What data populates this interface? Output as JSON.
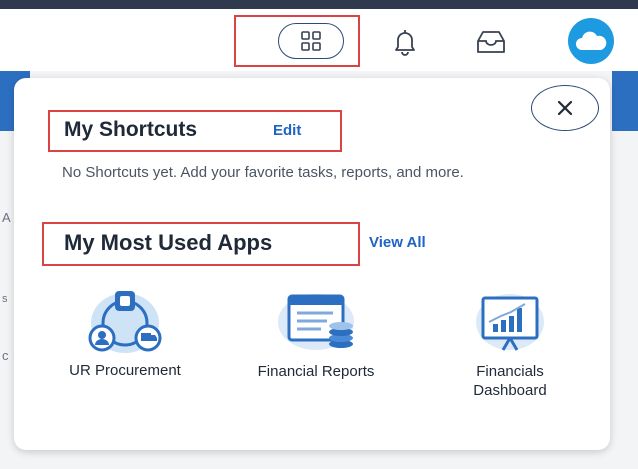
{
  "background": {
    "fragments": [
      "A",
      "s",
      "c"
    ]
  },
  "topbar": {
    "icons": [
      "apps-grid-icon",
      "bell-icon",
      "inbox-icon",
      "cloud-avatar-icon"
    ]
  },
  "panel": {
    "shortcuts": {
      "title": "My Shortcuts",
      "edit_label": "Edit",
      "empty_text": "No Shortcuts yet. Add your favorite tasks, reports, and more."
    },
    "most_used": {
      "title": "My Most Used Apps",
      "view_all_label": "View All",
      "apps": [
        {
          "label": "UR Procurement",
          "icon": "procurement-icon"
        },
        {
          "label": "Financial Reports",
          "icon": "financial-reports-icon"
        },
        {
          "label_line1": "Financials",
          "label_line2": "Dashboard",
          "icon": "financials-dashboard-icon"
        }
      ]
    }
  },
  "colors": {
    "accent": "#1f63c6",
    "highlight": "#d84343",
    "outline": "#2c4a79",
    "avatar": "#1e9be0"
  }
}
